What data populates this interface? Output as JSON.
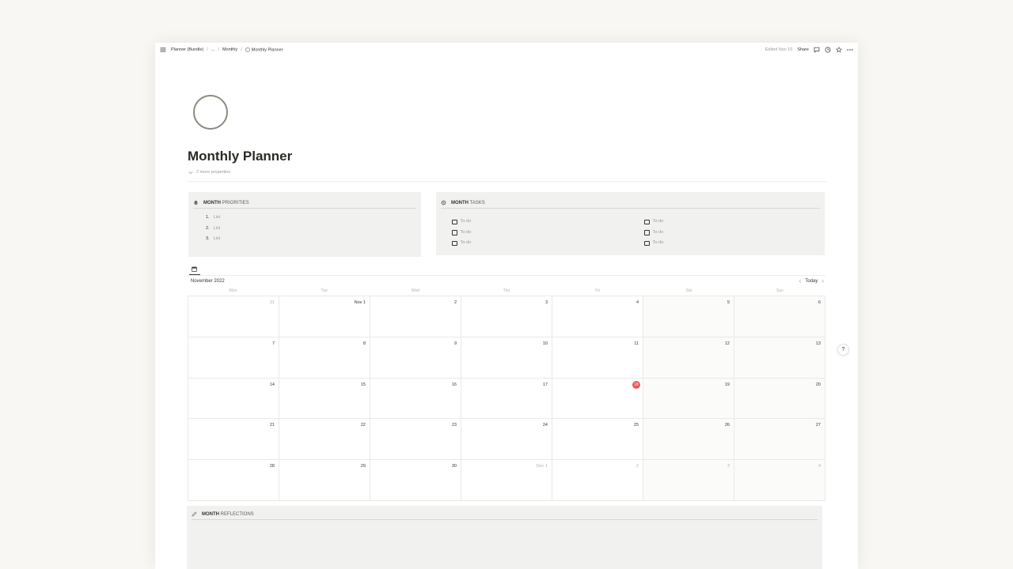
{
  "breadcrumb": {
    "items": [
      "Planner (Bundle)",
      "...",
      "Monthly",
      "Monthly Planner"
    ]
  },
  "topbar": {
    "edited": "Edited Nov 10",
    "share_label": "Share",
    "icons": [
      "comment-icon",
      "clock-icon",
      "star-icon",
      "more-icon"
    ]
  },
  "page": {
    "title": "Monthly Planner",
    "properties_toggle": "2 more properties"
  },
  "priorities": {
    "title_bold": "MONTH",
    "title_rest": "PRIORITIES",
    "items": [
      {
        "num": "1.",
        "text": "List"
      },
      {
        "num": "2.",
        "text": "List"
      },
      {
        "num": "3.",
        "text": "List"
      }
    ]
  },
  "tasks": {
    "title_bold": "MONTH",
    "title_rest": "TASKS",
    "left": [
      "To-do",
      "To-do",
      "To-do"
    ],
    "right": [
      "To-do",
      "To-do",
      "To-do"
    ]
  },
  "calendar": {
    "month_label": "November 2022",
    "today_label": "Today",
    "weekdays": [
      "Mon",
      "Tue",
      "Wed",
      "Thu",
      "Fri",
      "Sat",
      "Sun"
    ],
    "today": "18",
    "days": [
      [
        "31",
        "Nov 1",
        "2",
        "3",
        "4",
        "5",
        "6"
      ],
      [
        "7",
        "8",
        "9",
        "10",
        "11",
        "12",
        "13"
      ],
      [
        "14",
        "15",
        "16",
        "17",
        "18",
        "19",
        "20"
      ],
      [
        "21",
        "22",
        "23",
        "24",
        "25",
        "26",
        "27"
      ],
      [
        "28",
        "29",
        "30",
        "Dec 1",
        "2",
        "3",
        "4"
      ]
    ],
    "muted": [
      [
        0,
        0
      ],
      [
        4,
        3
      ],
      [
        4,
        4
      ],
      [
        4,
        5
      ],
      [
        4,
        6
      ]
    ]
  },
  "reflections": {
    "title_bold": "MONTH",
    "title_rest": "REFLECTIONS"
  },
  "help": {
    "label": "?"
  },
  "colors": {
    "today": "#eb5757",
    "callout_bg": "#f1f1ef",
    "page_bg": "#f8f7f3"
  }
}
